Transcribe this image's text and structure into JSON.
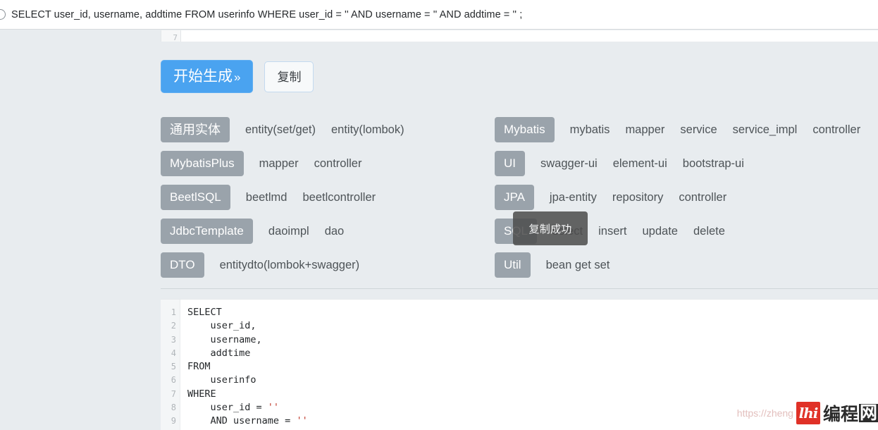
{
  "topbar": {
    "icon": "circle-icon",
    "sql_preview": "SELECT user_id, username, addtime FROM userinfo WHERE user_id = '' AND username = '' AND addtime = '' ;"
  },
  "editor_cut": {
    "line_number": "7"
  },
  "actions": {
    "generate_label": "开始生成",
    "generate_chevron": "»",
    "copy_label": "复制"
  },
  "toast": {
    "message": "复制成功"
  },
  "groups_left": [
    {
      "tag": "通用实体",
      "tag_name": "common-entity",
      "options": [
        "entity(set/get)",
        "entity(lombok)"
      ]
    },
    {
      "tag": "MybatisPlus",
      "tag_name": "mybatisplus",
      "options": [
        "mapper",
        "controller"
      ]
    },
    {
      "tag": "BeetlSQL",
      "tag_name": "beetlsql",
      "options": [
        "beetlmd",
        "beetlcontroller"
      ]
    },
    {
      "tag": "JdbcTemplate",
      "tag_name": "jdbctemplate",
      "options": [
        "daoimpl",
        "dao"
      ]
    },
    {
      "tag": "DTO",
      "tag_name": "dto",
      "options": [
        "entitydto(lombok+swagger)"
      ]
    }
  ],
  "groups_right": [
    {
      "tag": "Mybatis",
      "tag_name": "mybatis",
      "options": [
        "mybatis",
        "mapper",
        "service",
        "service_impl",
        "controller"
      ]
    },
    {
      "tag": "UI",
      "tag_name": "ui",
      "options": [
        "swagger-ui",
        "element-ui",
        "bootstrap-ui"
      ]
    },
    {
      "tag": "JPA",
      "tag_name": "jpa",
      "options": [
        "jpa-entity",
        "repository",
        "controller"
      ]
    },
    {
      "tag": "SQL",
      "tag_name": "sql",
      "options": [
        "select",
        "insert",
        "update",
        "delete"
      ]
    },
    {
      "tag": "Util",
      "tag_name": "util",
      "options": [
        "bean get set"
      ]
    }
  ],
  "code": {
    "line_numbers": [
      "1",
      "2",
      "3",
      "4",
      "5",
      "6",
      "7",
      "8",
      "9"
    ],
    "lines": [
      {
        "text": "SELECT",
        "indent": 0
      },
      {
        "text": "user_id,",
        "indent": 4
      },
      {
        "text": "username,",
        "indent": 4
      },
      {
        "text": "addtime",
        "indent": 4
      },
      {
        "text": "FROM",
        "indent": 0
      },
      {
        "text": "userinfo",
        "indent": 4
      },
      {
        "text": "WHERE",
        "indent": 0
      },
      {
        "text": "user_id = ",
        "indent": 4,
        "string": "''"
      },
      {
        "text": "AND username = ",
        "indent": 4,
        "string": "''"
      }
    ]
  },
  "watermark": {
    "url": "https://zheng",
    "logo_glyph": "lhi",
    "site_name": "编程",
    "site_name_boxed": "网"
  },
  "colors": {
    "accent_blue": "#4aa3f0",
    "tag_gray": "#9aa3ab",
    "panel_bg": "#e8ecef",
    "toast_bg": "#4d4d4d",
    "string_red": "#c0392b",
    "logo_red": "#e03127"
  }
}
